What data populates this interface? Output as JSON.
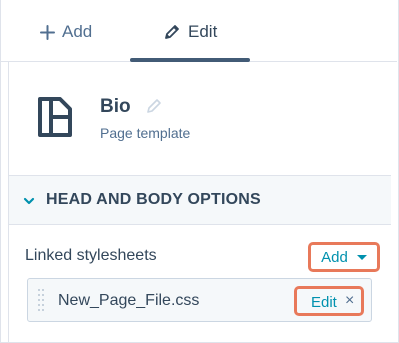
{
  "tabs": [
    {
      "label": "Add",
      "icon": "plus-icon",
      "active": false
    },
    {
      "label": "Edit",
      "icon": "pencil-icon",
      "active": true
    }
  ],
  "module": {
    "title": "Bio",
    "subtitle": "Page template",
    "icon": "page-template-icon"
  },
  "section": {
    "title": "HEAD AND BODY OPTIONS",
    "expanded": true
  },
  "linked_stylesheets": {
    "label": "Linked stylesheets",
    "add_label": "Add",
    "files": [
      {
        "name": "New_Page_File.css",
        "edit_label": "Edit",
        "remove_label": "×"
      }
    ]
  },
  "colors": {
    "text": "#33475b",
    "link": "#0091ae",
    "highlight": "#e8795a",
    "section_bg": "#f5f8fa",
    "border": "#dfe3eb"
  }
}
